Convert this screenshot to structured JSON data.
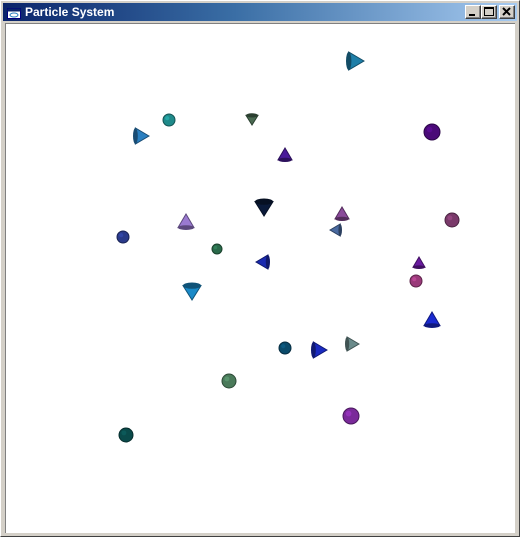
{
  "window": {
    "title": "Particle System",
    "icon": "app-window-icon",
    "controls": {
      "minimize": "minimize-icon",
      "maximize": "maximize-icon",
      "close": "close-icon"
    }
  },
  "scene": {
    "background": "#ffffff",
    "particles": [
      {
        "shape": "cone-right",
        "color": "#1f7fa8"
      },
      {
        "shape": "sphere",
        "color": "#1f8a8a"
      },
      {
        "shape": "cone-down",
        "color": "#4a6a52"
      },
      {
        "shape": "cone-right",
        "color": "#2a7fc0"
      },
      {
        "shape": "sphere",
        "color": "#4a0a78"
      },
      {
        "shape": "cone-up",
        "color": "#4a1a9a"
      },
      {
        "shape": "cone-down",
        "color": "#0a1a3a"
      },
      {
        "shape": "cone-up",
        "color": "#8a4a9a"
      },
      {
        "shape": "sphere",
        "color": "#7a3a6a"
      },
      {
        "shape": "cone-up",
        "color": "#9a7ad0"
      },
      {
        "shape": "cone-left",
        "color": "#4a6aa0"
      },
      {
        "shape": "sphere",
        "color": "#2a3a8a"
      },
      {
        "shape": "sphere",
        "color": "#2a6a4a"
      },
      {
        "shape": "cone-left",
        "color": "#1a2ab0"
      },
      {
        "shape": "cone-up",
        "color": "#6a1aa0"
      },
      {
        "shape": "sphere",
        "color": "#9a3a7a"
      },
      {
        "shape": "cone-down",
        "color": "#1a8ac8"
      },
      {
        "shape": "cone-up",
        "color": "#1a2ad0"
      },
      {
        "shape": "sphere",
        "color": "#0a4a6a"
      },
      {
        "shape": "cone-right",
        "color": "#1a2ac0"
      },
      {
        "shape": "cone-right",
        "color": "#6a8a8a"
      },
      {
        "shape": "sphere",
        "color": "#4a7a5a"
      },
      {
        "shape": "sphere",
        "color": "#7a2a9a"
      },
      {
        "shape": "sphere",
        "color": "#0a4a4a"
      }
    ]
  }
}
